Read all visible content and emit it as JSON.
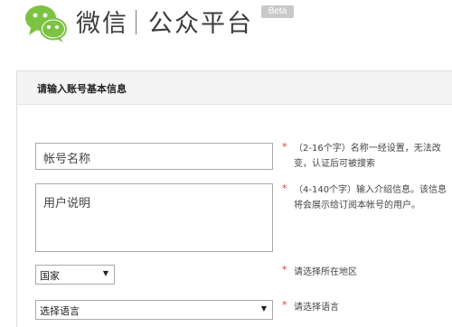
{
  "header": {
    "brand": "微信",
    "platform": "公众平台",
    "badge": "Beta"
  },
  "panel": {
    "title": "请输入账号基本信息"
  },
  "form": {
    "account_name": {
      "value": "帐号名称",
      "hint": "（2-16个字）名称一经设置，无法改变，认证后可被搜索"
    },
    "description": {
      "value": "用户说明",
      "hint": "（4-140个字）输入介绍信息。该信息将会展示给订阅本帐号的用户。"
    },
    "country": {
      "selected": "国家",
      "hint": "请选择所在地区"
    },
    "language": {
      "selected": "选择语言",
      "hint": "请选择语言"
    },
    "required_mark": "*"
  },
  "colors": {
    "logo_green": "#7cc243",
    "required": "#d83b3b",
    "panel_header": "#f4f4f4"
  }
}
